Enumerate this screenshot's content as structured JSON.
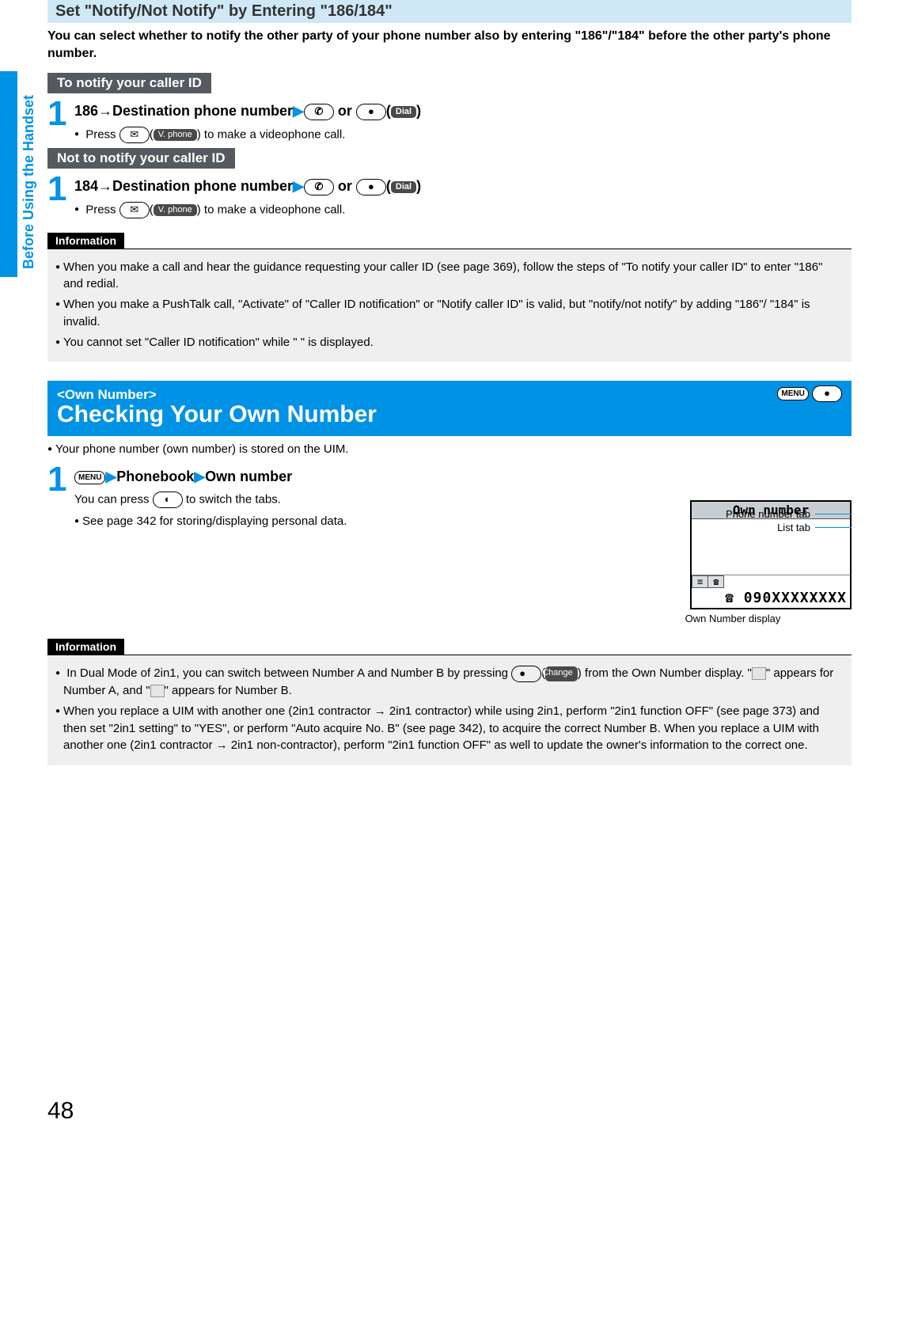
{
  "sideTab": "Before Using the Handset",
  "section1": {
    "title": "Set \"Notify/Not Notify\" by Entering \"186/184\"",
    "intro": "You can select whether to notify the other party of your phone number also by entering \"186\"/\"184\" before the other party's phone number.",
    "notify": {
      "header": "To notify your caller ID",
      "step": "186→Destination phone number",
      "or": " or ",
      "dial": "Dial",
      "sub": "Press ",
      "vphone": "V. phone",
      "subTail": " to make a videophone call."
    },
    "notNotify": {
      "header": "Not to notify your caller ID",
      "step": "184→Destination phone number",
      "or": " or ",
      "dial": "Dial",
      "sub": "Press ",
      "vphone": "V. phone",
      "subTail": " to make a videophone call."
    },
    "infoLabel": "Information",
    "info": [
      "When you make a call and hear the guidance requesting your caller ID (see page 369), follow the steps of \"To notify your caller ID\" to enter \"186\" and redial.",
      "When you make a PushTalk call, \"Activate\" of \"Caller ID notification\" or \"Notify caller ID\" is valid, but \"notify/not notify\" by adding \"186\"/ \"184\" is invalid.",
      "You cannot set \"Caller ID notification\" while \"  \" is displayed."
    ]
  },
  "section2": {
    "tag": "<Own Number>",
    "title": "Checking Your Own Number",
    "menuKey": "MENU",
    "lead": "Your phone number (own number) is stored on the UIM.",
    "step": {
      "a": "Phonebook",
      "b": "Own number"
    },
    "sub1": "You can press ",
    "sub1Tail": " to switch the tabs.",
    "sub2": "See page 342 for storing/displaying personal data.",
    "labels": {
      "phoneTab": "Phone number tab",
      "listTab": "List tab",
      "caption": "Own Number display"
    },
    "screen": {
      "title": "Own number",
      "number": "090XXXXXXXX"
    },
    "infoLabel": "Information",
    "info1a": "In Dual Mode of 2in1, you can switch between Number A and Number B by pressing ",
    "info1Change": "Change",
    "info1b": " from the Own Number display. \"",
    "info1c": "\" appears for Number A, and \"",
    "info1d": "\" appears for Number B.",
    "info2": "When you replace a UIM with another one (2in1 contractor → 2in1 contractor) while using 2in1, perform \"2in1 function OFF\" (see page 373) and then set \"2in1 setting\" to \"YES\", or perform \"Auto acquire No. B\" (see page 342), to acquire the correct Number B. When you replace a UIM with another one (2in1 contractor → 2in1 non-contractor), perform \"2in1 function OFF\" as well to update the owner's information to the correct one."
  },
  "pageNumber": "48"
}
